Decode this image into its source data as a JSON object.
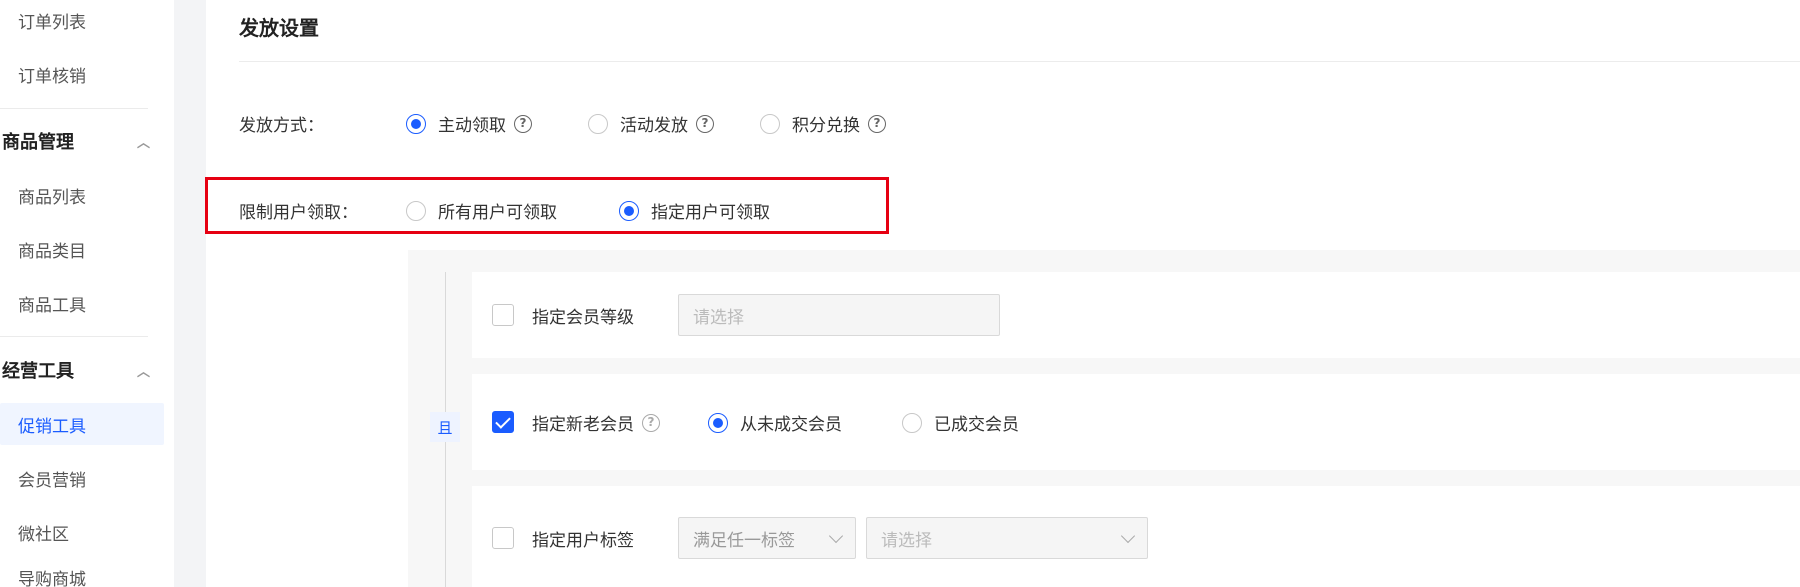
{
  "sidebar": {
    "orders": [
      {
        "label": "订单列表"
      },
      {
        "label": "订单核销"
      }
    ],
    "goods_group": {
      "label": "商品管理"
    },
    "goods": [
      {
        "label": "商品列表"
      },
      {
        "label": "商品类目"
      },
      {
        "label": "商品工具"
      }
    ],
    "ops_group": {
      "label": "经营工具"
    },
    "ops": [
      {
        "label": "促销工具",
        "active": true
      },
      {
        "label": "会员营销"
      },
      {
        "label": "微社区"
      },
      {
        "label": "导购商城"
      }
    ]
  },
  "section": {
    "title": "发放设置"
  },
  "issue_method": {
    "label": "发放方式：",
    "options": [
      {
        "label": "主动领取",
        "checked": true
      },
      {
        "label": "活动发放",
        "checked": false
      },
      {
        "label": "积分兑换",
        "checked": false
      }
    ]
  },
  "restrict": {
    "label": "限制用户领取：",
    "options": [
      {
        "label": "所有用户可领取",
        "checked": false
      },
      {
        "label": "指定用户可领取",
        "checked": true
      }
    ]
  },
  "conditions": {
    "and_label": "且",
    "member_level": {
      "label": "指定会员等级",
      "checked": false,
      "placeholder": "请选择"
    },
    "new_old": {
      "label": "指定新老会员",
      "checked": true,
      "options": [
        {
          "label": "从未成交会员",
          "checked": true
        },
        {
          "label": "已成交会员",
          "checked": false
        }
      ]
    },
    "tags": {
      "label": "指定用户标签",
      "checked": false,
      "mode": "满足任一标签",
      "placeholder": "请选择"
    }
  },
  "icons": {
    "help": "question-circle-icon",
    "collapse": "chevron-up-icon",
    "dropdown": "chevron-down-icon"
  },
  "colors": {
    "primary": "#1a5cff",
    "highlight": "#e60012"
  }
}
